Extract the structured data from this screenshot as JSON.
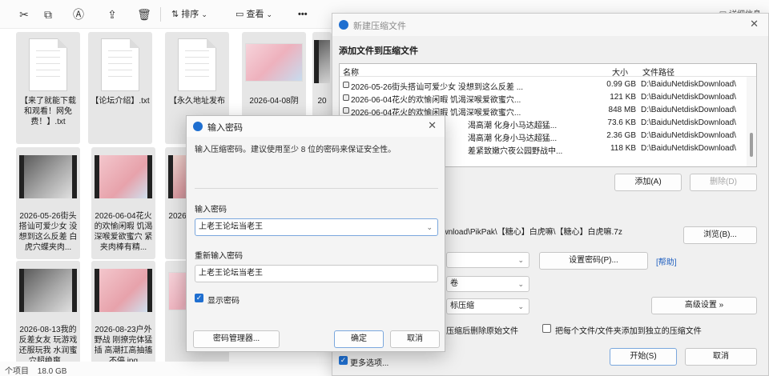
{
  "toolbar": {
    "icons": [
      "cut-icon",
      "copy-icon",
      "rename-icon",
      "share-icon",
      "delete-icon"
    ],
    "sort_label": "排序",
    "view_label": "查看",
    "more_label": "•••",
    "right_label": "详细信息"
  },
  "files": {
    "row1": [
      {
        "kind": "doc",
        "name": "【来了就能下载和观看！网免费！】.txt"
      },
      {
        "kind": "doc",
        "name": "【论坛介绍】.txt"
      },
      {
        "kind": "doc",
        "name": "【永久地址发布"
      },
      {
        "kind": "img",
        "name": "2026-04-08阴"
      },
      {
        "kind": "vid",
        "name": "20"
      }
    ],
    "row2": [
      {
        "kind": "vid",
        "name": "2026-05-26街头搭讪可爱少女 没想到这么反差 白虎穴蝶夹肉..."
      },
      {
        "kind": "vid",
        "name": "2026-06-04花火的欢愉闲暇 饥渴深喉爱欲蜜穴 紧夹肉棒有精..."
      },
      {
        "kind": "vid",
        "name": "2026-06-04花火的"
      }
    ],
    "row3": [
      {
        "kind": "vid",
        "name": "2026-08-13我的反差女友 玩游戏还服玩我 水润蜜穴超绝爽..."
      },
      {
        "kind": "vid",
        "name": "2026-08-23户外野战 刚撩完体猛插 高潮扛高抽搐不停.jpg"
      },
      {
        "kind": "img",
        "name": ""
      }
    ]
  },
  "status": {
    "count": "个项目",
    "size": "18.0 GB"
  },
  "archive_dialog": {
    "title": "新建压缩文件",
    "heading": "添加文件到压缩文件",
    "columns": {
      "name": "名称",
      "size": "大小",
      "path": "文件路径"
    },
    "rows": [
      {
        "name": "2026-05-26街头搭讪可爱少女 没想到这么反差 ...",
        "size": "0.99 GB",
        "path": "D:\\BaiduNetdiskDownload\\"
      },
      {
        "name": "2026-06-04花火的欢愉闲暇 饥渴深喉爱欲蜜穴...",
        "size": "121 KB",
        "path": "D:\\BaiduNetdiskDownload\\"
      },
      {
        "name": "2026-06-04花火的欢愉闲暇 饥渴深喉爱欲蜜穴...",
        "size": "848 MB",
        "path": "D:\\BaiduNetdiskDownload\\"
      },
      {
        "name": "渴高潮 化身小马达超猛...",
        "size": "73.6 KB",
        "path": "D:\\BaiduNetdiskDownload\\"
      },
      {
        "name": "渴高潮 化身小马达超猛...",
        "size": "2.36 GB",
        "path": "D:\\BaiduNetdiskDownload\\"
      },
      {
        "name": "差紧致嫩穴夜公园野战中...",
        "size": "118 KB",
        "path": "D:\\BaiduNetdiskDownload\\"
      }
    ],
    "add_button": "添加(A)",
    "delete_button": "删除(D)",
    "archive_path": "tdiskDownload\\PikPak\\【糖心】白虎嘛\\【糖心】白虎嘛.7z",
    "browse_button": "浏览(B)...",
    "set_password_button": "设置密码(P)...",
    "help_link": "[帮助]",
    "split_option": "卷",
    "compress_option": "标压缩",
    "advanced_button": "高级设置 »",
    "delete_source_label": "压缩后删除原始文件",
    "separate_label": "把每个文件/文件夹添加到独立的压缩文件",
    "more_label": "更多选项...",
    "start_button": "开始(S)",
    "cancel_button": "取消"
  },
  "password_dialog": {
    "title": "输入密码",
    "description": "输入压缩密码。建议使用至少 8 位的密码来保证安全性。",
    "enter_label": "输入密码",
    "enter_value": "上老王论坛当老王",
    "reenter_label": "重新输入密码",
    "reenter_value": "上老王论坛当老王",
    "show_password_label": "显示密码",
    "manager_button": "密码管理器...",
    "ok_button": "确定",
    "cancel_button": "取消"
  }
}
